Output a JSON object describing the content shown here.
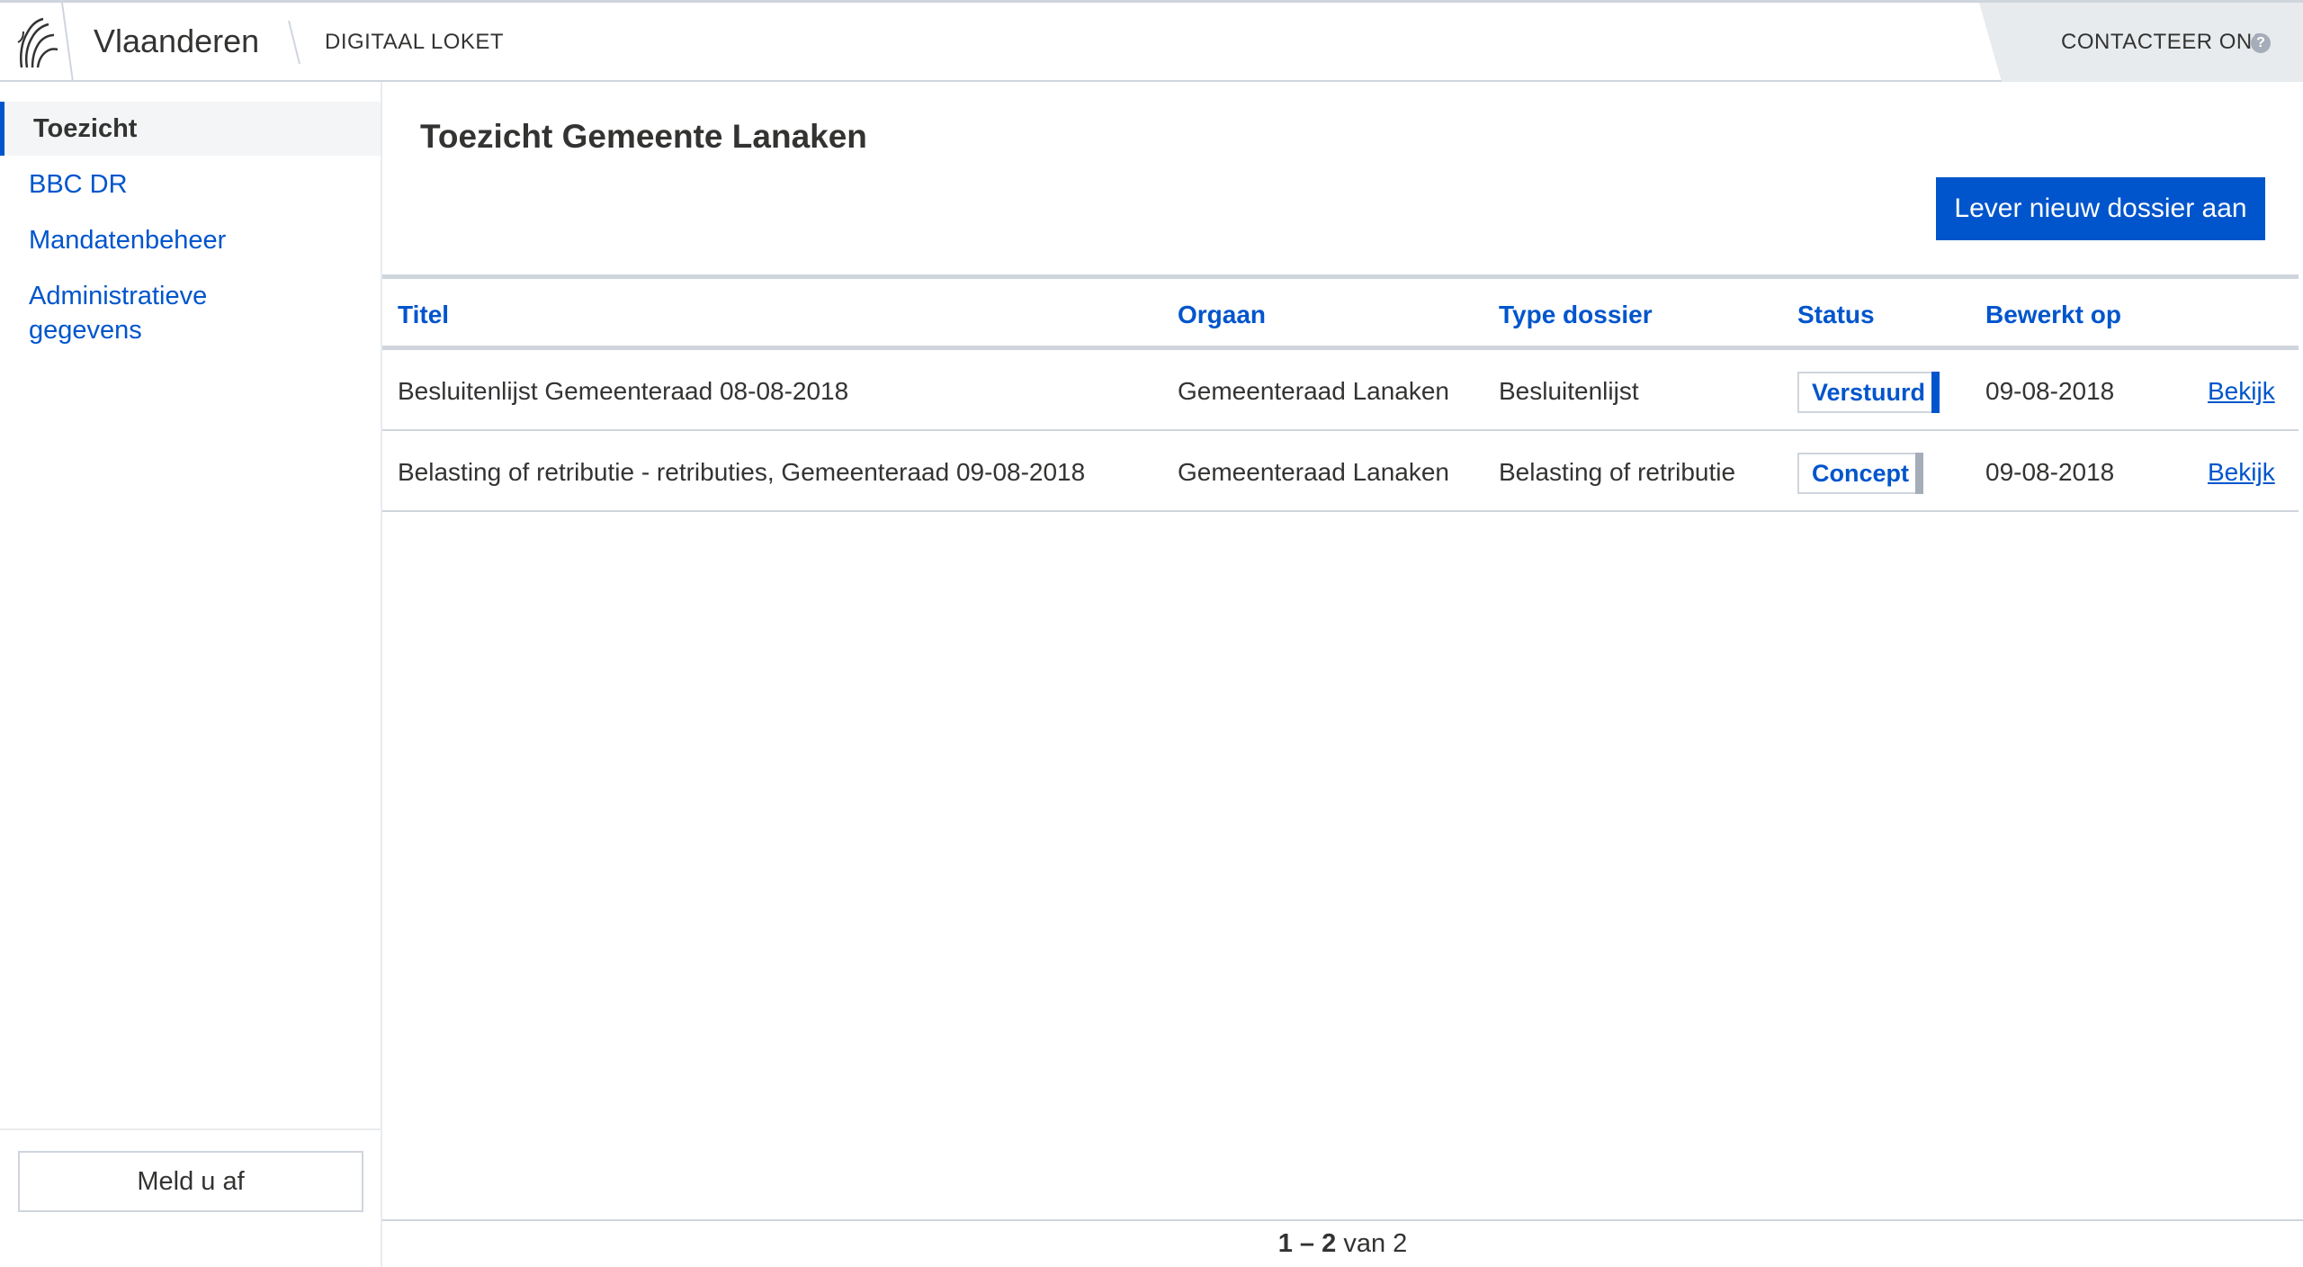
{
  "header": {
    "brand": "Vlaanderen",
    "app_name": "DIGITAAL LOKET",
    "contact_label": "CONTACTEER ONS",
    "help_glyph": "?",
    "logo_icon": "flemish-lion-icon"
  },
  "sidebar": {
    "items": [
      {
        "label": "Toezicht",
        "active": true
      },
      {
        "label": "BBC DR",
        "active": false
      },
      {
        "label": "Mandatenbeheer",
        "active": false
      },
      {
        "label_line1": "Administratieve",
        "label_line2": "gegevens",
        "active": false
      }
    ],
    "logout_label": "Meld u af"
  },
  "main": {
    "title": "Toezicht Gemeente Lanaken",
    "new_button_label": "Lever nieuw dossier aan",
    "table": {
      "headers": [
        "Titel",
        "Orgaan",
        "Type dossier",
        "Status",
        "Bewerkt op"
      ],
      "rows": [
        {
          "titel": "Besluitenlijst Gemeenteraad 08-08-2018",
          "orgaan": "Gemeenteraad Lanaken",
          "type": "Besluitenlijst",
          "status": "Verstuurd",
          "status_color": "#0055cc",
          "bewerkt": "09-08-2018",
          "action": "Bekijk"
        },
        {
          "titel": "Belasting of retributie - retributies, Gemeenteraad 09-08-2018",
          "orgaan": "Gemeenteraad Lanaken",
          "type": "Belasting of retributie",
          "status": "Concept",
          "status_color": "#a5adb8",
          "bewerkt": "09-08-2018",
          "action": "Bekijk"
        }
      ]
    },
    "pager": {
      "range_start": "1",
      "range_sep": "–",
      "range_end": "2",
      "of_label": "van",
      "total": "2"
    }
  },
  "colors": {
    "accent": "#0055cc",
    "border": "#cfd5dd",
    "contact_bg": "#e8ebee",
    "text": "#333332"
  }
}
